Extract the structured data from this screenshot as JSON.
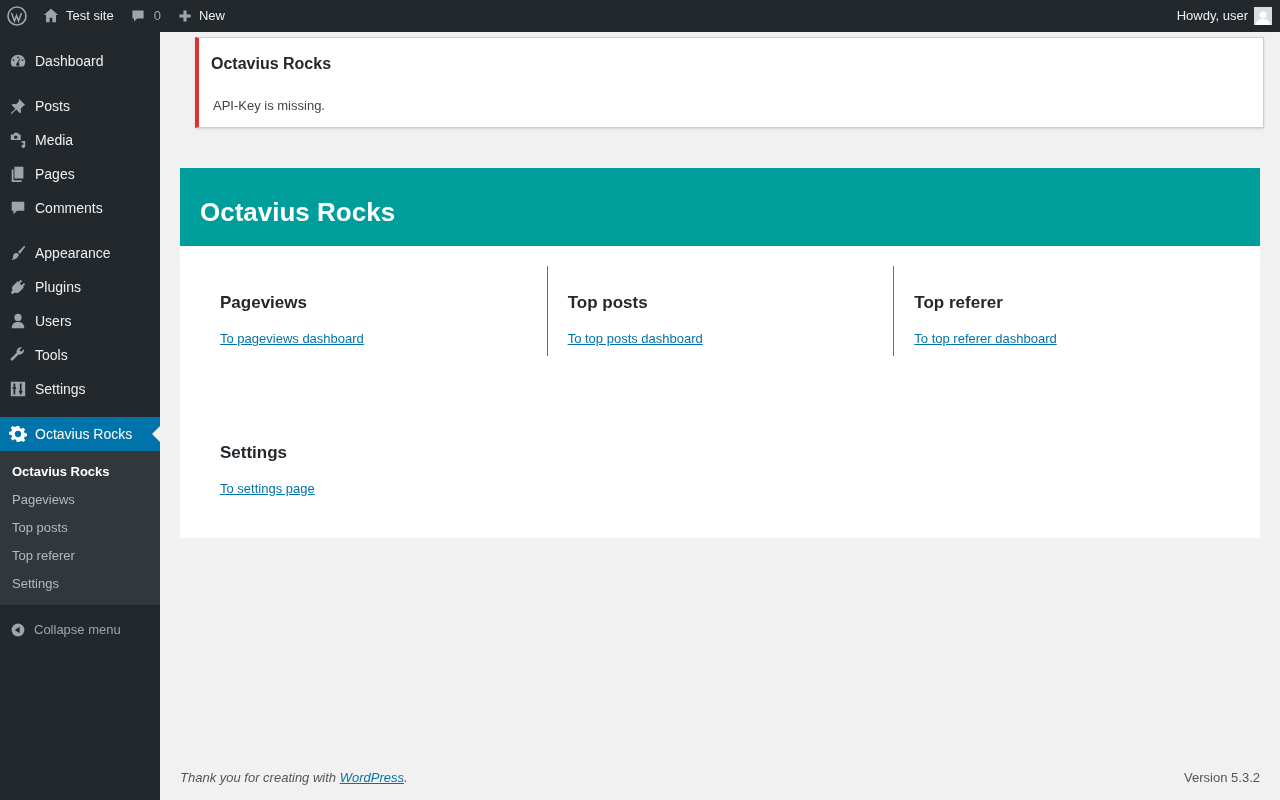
{
  "admin_bar": {
    "site": "Test site",
    "comments": "0",
    "new": "New",
    "greeting": "Howdy, user"
  },
  "sidebar": {
    "groups": [
      [
        {
          "label": "Dashboard",
          "selected": false
        }
      ],
      [
        {
          "label": "Posts",
          "selected": false
        },
        {
          "label": "Media",
          "selected": false
        },
        {
          "label": "Pages",
          "selected": false
        },
        {
          "label": "Comments",
          "selected": false
        }
      ],
      [
        {
          "label": "Appearance",
          "selected": false
        },
        {
          "label": "Plugins",
          "selected": false
        },
        {
          "label": "Users",
          "selected": false
        },
        {
          "label": "Tools",
          "selected": false
        },
        {
          "label": "Settings",
          "selected": false
        }
      ],
      [
        {
          "label": "Octavius Rocks",
          "selected": true,
          "children": [
            {
              "label": "Octavius Rocks",
              "selected": true
            },
            {
              "label": "Pageviews",
              "selected": false
            },
            {
              "label": "Top posts",
              "selected": false
            },
            {
              "label": "Top referer",
              "selected": false
            },
            {
              "label": "Settings",
              "selected": false
            }
          ]
        }
      ]
    ],
    "collapse": "Collapse menu"
  },
  "notice": {
    "title": "Octavius Rocks",
    "message": "API-Key is missing."
  },
  "panel": {
    "title": "Octavius Rocks",
    "rows": [
      [
        {
          "title": "Pageviews",
          "link": "To pageviews dashboard"
        },
        {
          "title": "Top posts",
          "link": "To top posts dashboard"
        },
        {
          "title": "Top referer",
          "link": "To top referer dashboard"
        }
      ],
      [
        {
          "title": "Settings",
          "link": "To settings page"
        }
      ]
    ]
  },
  "footer": {
    "text_before": "Thank you for creating with ",
    "link": "WordPress",
    "text_after": ".",
    "version": "Version 5.3.2"
  }
}
